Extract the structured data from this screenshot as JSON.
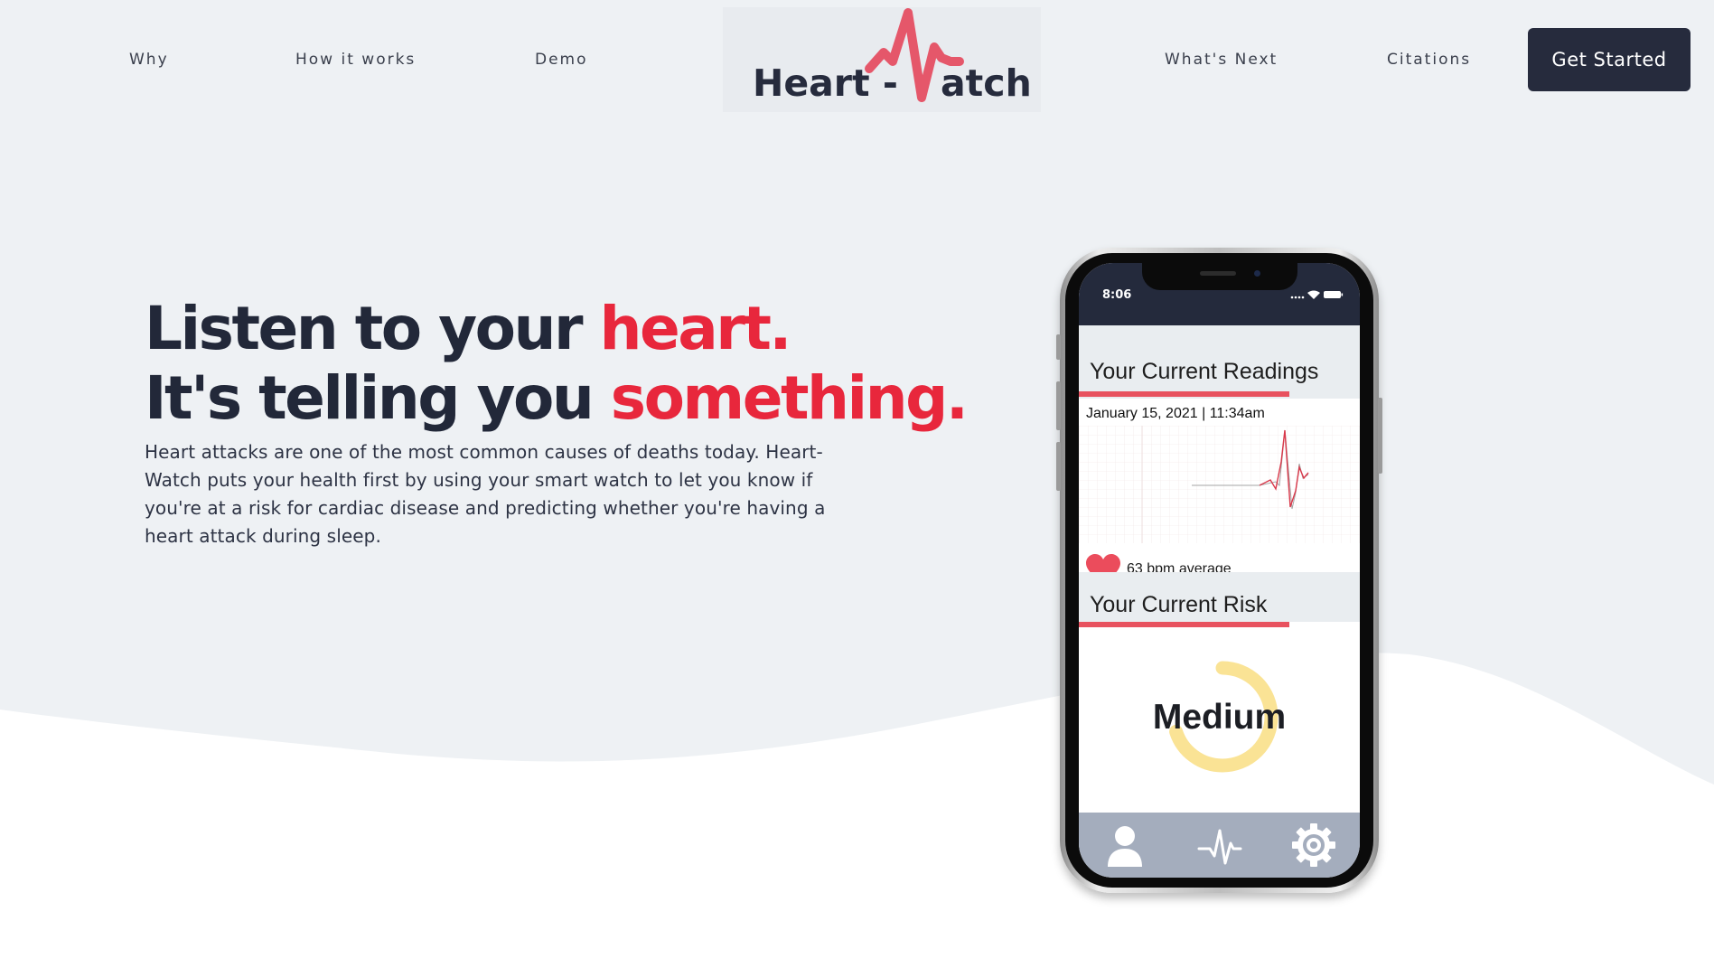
{
  "nav": {
    "links": [
      "Why",
      "How it works",
      "Demo",
      "What's Next",
      "Citations"
    ],
    "logo": {
      "text_left": "Heart -",
      "text_right": "atch"
    },
    "cta_label": "Get Started"
  },
  "hero": {
    "line1_prefix": "Listen to your ",
    "line1_accent": "heart.",
    "line2_prefix": "It's telling you ",
    "line2_accent": "something.",
    "description": "Heart attacks are one of the most common causes of deaths today. Heart-Watch puts your health first by using your smart watch to let you know if you're at a risk for cardiac disease and predicting whether you're having a heart attack during sleep."
  },
  "phone": {
    "status_time": "8:06",
    "readings_title": "Your Current Readings",
    "reading_datetime": "January 15, 2021 | 11:34am",
    "bpm_text": "63 bpm average",
    "risk_title": "Your Current Risk",
    "risk_level": "Medium",
    "risk_gauge_fraction": 0.7,
    "tabs": [
      "profile-icon",
      "pulse-icon",
      "settings-icon"
    ]
  },
  "colors": {
    "background": "#eef1f4",
    "accent": "#e8273c",
    "dark": "#262b3d",
    "gauge": "#fae395",
    "section_bar": "#e8525f"
  }
}
